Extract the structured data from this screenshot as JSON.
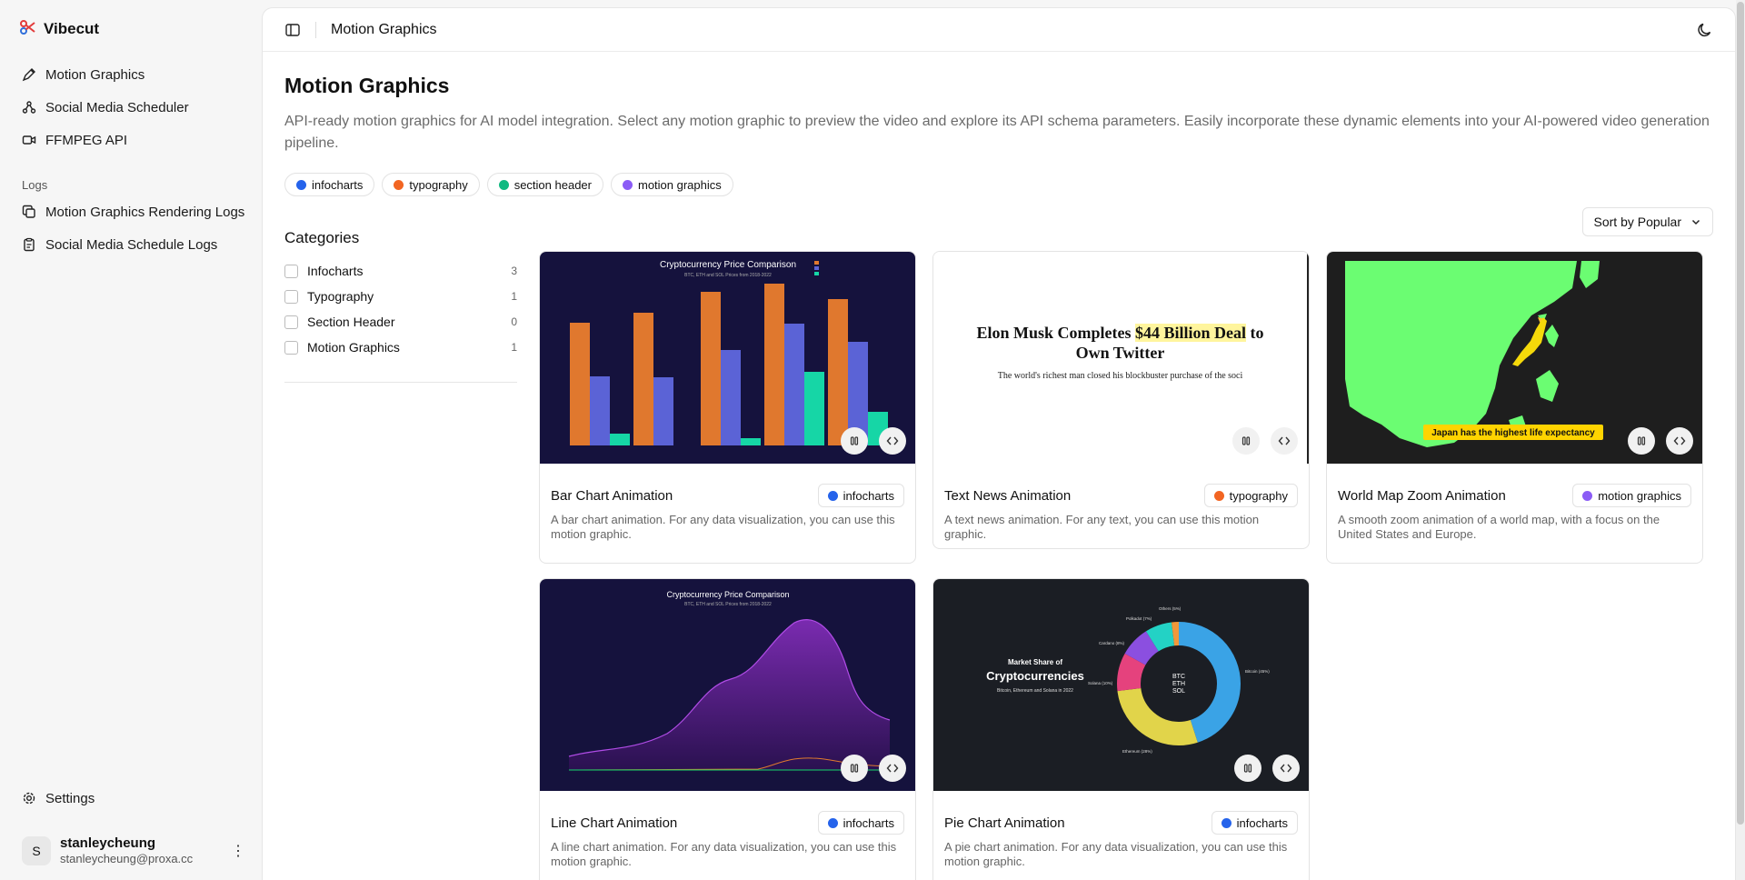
{
  "app": {
    "name": "Vibecut"
  },
  "sidebar": {
    "items": [
      {
        "label": "Motion Graphics",
        "icon": "pen-tool-icon"
      },
      {
        "label": "Social Media Scheduler",
        "icon": "share-nodes-icon"
      },
      {
        "label": "FFMPEG API",
        "icon": "video-icon"
      }
    ],
    "logs_label": "Logs",
    "logs": [
      {
        "label": "Motion Graphics Rendering Logs",
        "icon": "copy-icon"
      },
      {
        "label": "Social Media Schedule Logs",
        "icon": "clipboard-icon"
      }
    ],
    "settings_label": "Settings",
    "user": {
      "initial": "S",
      "name": "stanleycheung",
      "email": "stanleycheung@proxa.cc"
    }
  },
  "topbar": {
    "title": "Motion Graphics"
  },
  "page": {
    "title": "Motion Graphics",
    "description": "API-ready motion graphics for AI model integration. Select any motion graphic to preview the video and explore its API schema parameters. Easily incorporate these dynamic elements into your AI-powered video generation pipeline."
  },
  "chips": [
    {
      "label": "infocharts",
      "color": "#2563eb"
    },
    {
      "label": "typography",
      "color": "#f26522"
    },
    {
      "label": "section header",
      "color": "#10b981"
    },
    {
      "label": "motion graphics",
      "color": "#8b5cf6"
    }
  ],
  "filters": {
    "title": "Categories",
    "items": [
      {
        "label": "Infocharts",
        "count": "3"
      },
      {
        "label": "Typography",
        "count": "1"
      },
      {
        "label": "Section Header",
        "count": "0"
      },
      {
        "label": "Motion Graphics",
        "count": "1"
      }
    ]
  },
  "sort": {
    "label": "Sort by Popular"
  },
  "cards": [
    {
      "title": "Bar Chart Animation",
      "tag": "infocharts",
      "tag_color": "#2563eb",
      "desc": "A bar chart animation. For any data visualization, you can use this motion graphic."
    },
    {
      "title": "Text News Animation",
      "tag": "typography",
      "tag_color": "#f26522",
      "desc": "A text news animation. For any text, you can use this motion graphic."
    },
    {
      "title": "World Map Zoom Animation",
      "tag": "motion graphics",
      "tag_color": "#8b5cf6",
      "desc": "A smooth zoom animation of a world map, with a focus on the United States and Europe."
    },
    {
      "title": "Line Chart Animation",
      "tag": "infocharts",
      "tag_color": "#2563eb",
      "desc": "A line chart animation. For any data visualization, you can use this motion graphic."
    },
    {
      "title": "Pie Chart Animation",
      "tag": "infocharts",
      "tag_color": "#2563eb",
      "desc": "A pie chart animation. For any data visualization, you can use this motion graphic."
    }
  ],
  "thumbs": {
    "bar": {
      "title": "Cryptocurrency Price Comparison",
      "subtitle": "BTC, ETH and SOL Prices from 2018-2022"
    },
    "news": {
      "headline_pre": "Elon Musk Completes ",
      "headline_highlight": "$44 Billion Deal",
      "headline_post": " to Own Twitter",
      "sub": "The world's richest man closed his blockbuster purchase of the soci"
    },
    "map": {
      "caption": "Japan has the highest life expectancy"
    },
    "line": {
      "title": "Cryptocurrency Price Comparison",
      "subtitle": "BTC, ETH and SOL Prices from 2018-2022"
    },
    "pie": {
      "title_small": "Market Share of",
      "title_big": "Cryptocurrencies",
      "subtitle": "Bitcoin, Ethereum and Solana in 2022",
      "center": [
        "BTC",
        "ETH",
        "SOL"
      ],
      "labels": [
        "Bitcoin (45%)",
        "Ethereum (28%)",
        "Solana (10%)",
        "Cardano (8%)",
        "Polkadot (7%)",
        "Others (5%)"
      ]
    }
  }
}
